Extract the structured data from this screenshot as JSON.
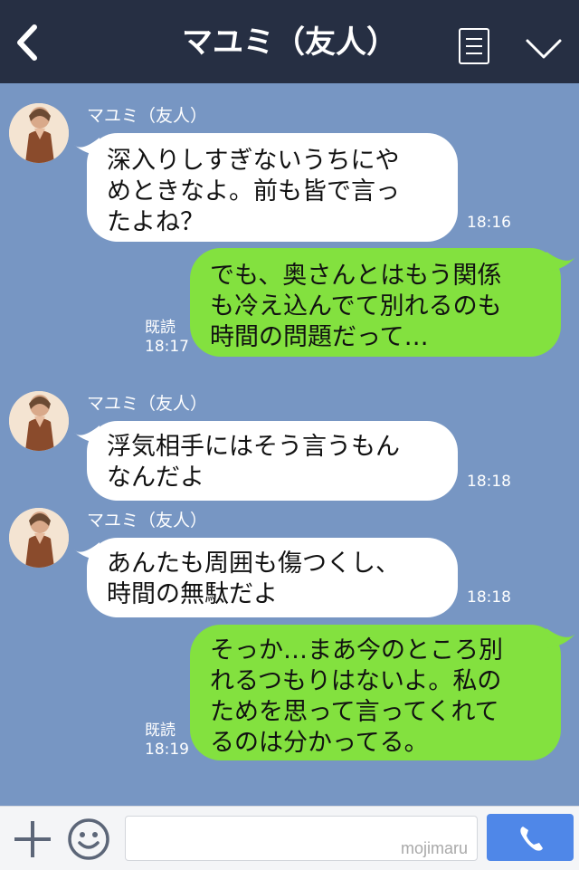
{
  "header": {
    "title": "マユミ（友人）",
    "back_icon": "chevron-left-icon",
    "menu_icon": "notes-icon",
    "toggle_icon": "chevron-down-icon"
  },
  "messages": [
    {
      "sender": "マユミ（友人）",
      "direction": "incoming",
      "lines": [
        "深入りしすぎないうちにや",
        "めときなよ。前も皆で言っ",
        "たよね？"
      ],
      "time": "18:16"
    },
    {
      "direction": "outgoing",
      "lines": [
        "でも、奥さんとはもう関係",
        "も冷え込んでて別れるのも",
        "時間の問題だって…"
      ],
      "read": "既読",
      "time": "18:17"
    },
    {
      "sender": "マユミ（友人）",
      "direction": "incoming",
      "lines": [
        "浮気相手にはそう言うもん",
        "なんだよ"
      ],
      "time": "18:18"
    },
    {
      "sender": "マユミ（友人）",
      "direction": "incoming",
      "lines": [
        "あんたも周囲も傷つくし、",
        "時間の無駄だよ"
      ],
      "time": "18:18"
    },
    {
      "direction": "outgoing",
      "lines": [
        "そっか…まあ今のところ別",
        "れるつもりはないよ。私の",
        "ためを思って言ってくれて",
        "るのは分かってる。"
      ],
      "read": "既読",
      "time": "18:19"
    }
  ],
  "footer": {
    "plus_icon": "plus-icon",
    "sticker_icon": "smiley-icon",
    "input_value": "",
    "watermark": "mojimaru",
    "call_icon": "phone-icon"
  },
  "colors": {
    "header_bg": "#262f43",
    "chat_bg": "#7796c3",
    "incoming_bubble": "#ffffff",
    "outgoing_bubble": "#83e13f",
    "call_button": "#4f87e8"
  }
}
